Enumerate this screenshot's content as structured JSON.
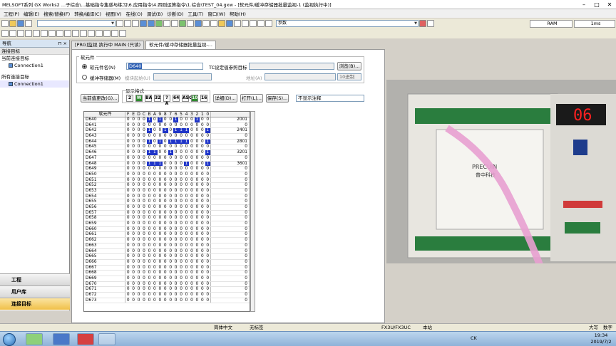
{
  "window": {
    "title": "MELSOFT系列 GX Works2 ...子综合\\...基础指令集惑与练习\\6.应用指令\\4.四则运算指令\\1.综合\\TEST_04.gxw - [软元件/缓冲存储器批量监视-1 (监视执行中)]"
  },
  "menu": [
    "工程(P)",
    "编辑(E)",
    "搜索/替换(F)",
    "转换/编译(C)",
    "视图(V)",
    "在线(O)",
    "调试(B)",
    "诊断(D)",
    "工具(T)",
    "窗口(W)",
    "帮助(H)"
  ],
  "toolbar": {
    "param_label": "参数",
    "ram_label": "RAM",
    "scan_label": "1ms"
  },
  "nav": {
    "title": "导航",
    "section_current": "连接目标",
    "current_label": "当前连接目标",
    "current_item": "Connection1",
    "all_label": "所有连接目标",
    "all_item": "Connection1",
    "btn_project": "工程",
    "btn_userlib": "用户库",
    "btn_connection": "连接目标"
  },
  "tabs": [
    {
      "label": "[PRG]监视 执行中 MAIN (只读)"
    },
    {
      "label": "软元件/缓冲存储器批量监视-..."
    }
  ],
  "panel": {
    "device_group": "软元件",
    "device_name_label": "软元件名(N)",
    "device_value": "D640",
    "tc_label": "TC设定值参照目标",
    "browse_btn": "浏览(B)...",
    "buffer_label": "缓冲存储器(M)",
    "module_start_label": "模块起始(U)",
    "address_label": "地址(A)",
    "radix_value": "10进制",
    "display_fmt_label": "显示格式",
    "change_btn": "当前值更改(G)...",
    "fmt_buttons": [
      "2",
      "W",
      "BA",
      "32",
      "?A",
      "64",
      "ASC",
      "10",
      "16"
    ],
    "details_btn": "详细(D)...",
    "open_btn": "打开(L)...",
    "save_btn": "保存(S)...",
    "comment_select": "不显示注释"
  },
  "grid": {
    "headers": {
      "device": "软元件",
      "bits": [
        "F",
        "E",
        "D",
        "C",
        "B",
        "A",
        "9",
        "8",
        "7",
        "6",
        "5",
        "4",
        "3",
        "2",
        "1",
        "0"
      ],
      "value": ""
    },
    "rows": [
      {
        "device": "D640",
        "bits": "0000101001000100",
        "value": "2001"
      },
      {
        "device": "D641",
        "bits": "0000000000000000",
        "value": "0"
      },
      {
        "device": "D642",
        "bits": "0000100101110001",
        "value": "2401"
      },
      {
        "device": "D643",
        "bits": "0000000000000000",
        "value": "0"
      },
      {
        "device": "D644",
        "bits": "0000101011110001",
        "value": "2801"
      },
      {
        "device": "D645",
        "bits": "0000000000000000",
        "value": "0"
      },
      {
        "device": "D646",
        "bits": "0000110010000001",
        "value": "3201"
      },
      {
        "device": "D647",
        "bits": "0000000000000000",
        "value": "0"
      },
      {
        "device": "D648",
        "bits": "0000111000010001",
        "value": "3601"
      },
      {
        "device": "D649",
        "bits": "0000000000000000",
        "value": "0"
      },
      {
        "device": "D650",
        "bits": "0000000000000000",
        "value": "0"
      },
      {
        "device": "D651",
        "bits": "0000000000000000",
        "value": "0"
      },
      {
        "device": "D652",
        "bits": "0000000000000000",
        "value": "0"
      },
      {
        "device": "D653",
        "bits": "0000000000000000",
        "value": "0"
      },
      {
        "device": "D654",
        "bits": "0000000000000000",
        "value": "0"
      },
      {
        "device": "D655",
        "bits": "0000000000000000",
        "value": "0"
      },
      {
        "device": "D656",
        "bits": "0000000000000000",
        "value": "0"
      },
      {
        "device": "D657",
        "bits": "0000000000000000",
        "value": "0"
      },
      {
        "device": "D658",
        "bits": "0000000000000000",
        "value": "0"
      },
      {
        "device": "D659",
        "bits": "0000000000000000",
        "value": "0"
      },
      {
        "device": "D660",
        "bits": "0000000000000000",
        "value": "0"
      },
      {
        "device": "D661",
        "bits": "0000000000000000",
        "value": "0"
      },
      {
        "device": "D662",
        "bits": "0000000000000000",
        "value": "0"
      },
      {
        "device": "D663",
        "bits": "0000000000000000",
        "value": "0"
      },
      {
        "device": "D664",
        "bits": "0000000000000000",
        "value": "0"
      },
      {
        "device": "D665",
        "bits": "0000000000000000",
        "value": "0"
      },
      {
        "device": "D666",
        "bits": "0000000000000000",
        "value": "0"
      },
      {
        "device": "D667",
        "bits": "0000000000000000",
        "value": "0"
      },
      {
        "device": "D668",
        "bits": "0000000000000000",
        "value": "0"
      },
      {
        "device": "D669",
        "bits": "0000000000000000",
        "value": "0"
      },
      {
        "device": "D670",
        "bits": "0000000000000000",
        "value": "0"
      },
      {
        "device": "D671",
        "bits": "0000000000000000",
        "value": "0"
      },
      {
        "device": "D672",
        "bits": "0000000000000000",
        "value": "0"
      },
      {
        "device": "D673",
        "bits": "0000000000000000",
        "value": "0"
      }
    ]
  },
  "photo": {
    "display_value": "06",
    "brand": "PRECUIN",
    "brand_cn": "普中科技"
  },
  "status": {
    "lang": "简体中文",
    "label": "无标签",
    "plc": "FX3U/FX3UC",
    "station": "本站",
    "caps": "大写",
    "num": "数字"
  },
  "taskbar": {
    "time": "19:34",
    "date": "2019/7/2",
    "lang": "CK"
  },
  "colors": {
    "bit_on": "#1f35c8",
    "seg": "#ff2020"
  }
}
